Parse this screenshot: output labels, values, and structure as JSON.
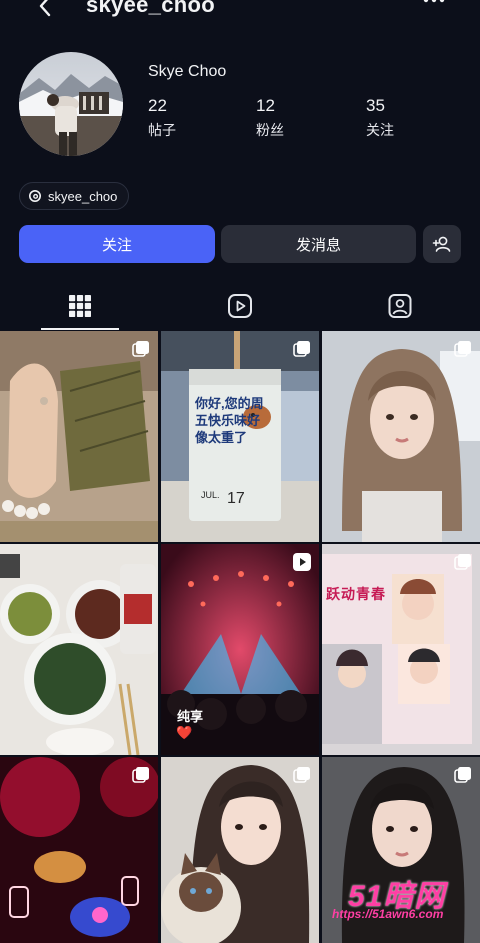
{
  "header": {
    "title": "skyee_choo",
    "back_icon": "chevron-left-icon",
    "more_icon": "more-dots-icon"
  },
  "profile": {
    "display_name": "Skye Choo",
    "stats": [
      {
        "value": "22",
        "label": "帖子"
      },
      {
        "value": "12",
        "label": "粉丝"
      },
      {
        "value": "35",
        "label": "关注"
      }
    ],
    "threads_handle": "skyee_choo"
  },
  "actions": {
    "follow": "关注",
    "message": "发消息",
    "add_icon": "add-person-icon",
    "follow_color": "#4a63f7"
  },
  "tabs": [
    {
      "icon": "grid-icon",
      "active": true
    },
    {
      "icon": "reels-icon",
      "active": false
    },
    {
      "icon": "tagged-icon",
      "active": false
    }
  ],
  "posts": {
    "cake_text": "你好,您的周五快乐味好像太重了",
    "cake_date_month": "JUL.",
    "cake_date_day": "17",
    "concert_caption": "纯享",
    "concert_heart": "❤️",
    "bag_text": "跃动青春"
  },
  "watermark": {
    "logo": "51暗网",
    "url": "https://51awn6.com"
  }
}
